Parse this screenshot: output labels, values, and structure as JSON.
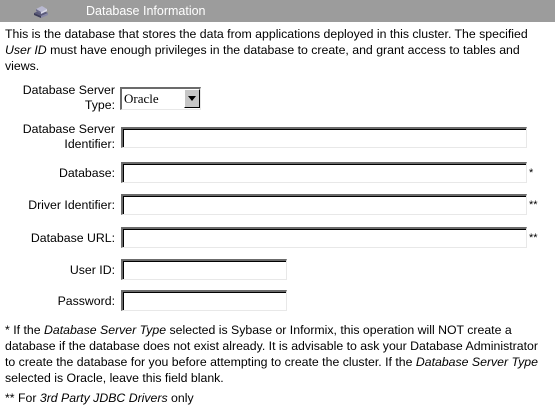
{
  "header": {
    "title": "Database Information",
    "icon": "database-icon"
  },
  "intro": {
    "part1": "This is the database that stores the data from applications deployed in this cluster. The specified ",
    "user_id_term": "User ID",
    "part2": " must have enough privileges in the database to create, and grant access to tables and views."
  },
  "form": {
    "server_type": {
      "label_line1": "Database Server",
      "label_line2": "Type:",
      "value": "Oracle"
    },
    "server_identifier": {
      "label_line1": "Database Server",
      "label_line2": "Identifier:",
      "value": ""
    },
    "database": {
      "label": "Database:",
      "value": "",
      "mark": "*"
    },
    "driver_identifier": {
      "label": "Driver Identifier:",
      "value": "",
      "mark": "**"
    },
    "database_url": {
      "label": "Database URL:",
      "value": "",
      "mark": "**"
    },
    "user_id": {
      "label": "User ID:",
      "value": ""
    },
    "password": {
      "label": "Password:",
      "value": ""
    }
  },
  "notes": {
    "single": {
      "part1": "* If the ",
      "term1": "Database Server Type",
      "part2": " selected is Sybase or Informix, this operation will NOT create a database if the database does not exist already. It is advisable to ask your Database Administrator to create the database for you before attempting to create the cluster. If the ",
      "term2": "Database Server Type",
      "part3": " selected is Oracle, leave this field blank."
    },
    "double": {
      "part1": "** For ",
      "term": "3rd Party JDBC Drivers",
      "part2": " only"
    }
  }
}
